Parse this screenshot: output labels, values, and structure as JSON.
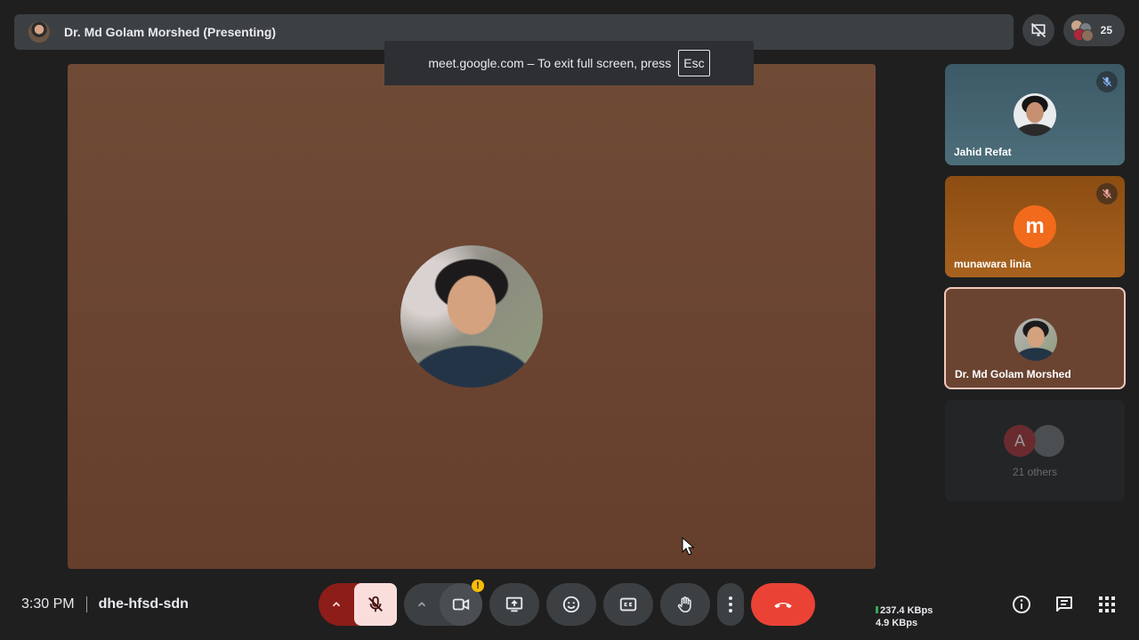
{
  "header": {
    "presenter_title": "Dr. Md Golam Morshed (Presenting)",
    "participant_count": "25"
  },
  "fullscreen_notice": {
    "text": "meet.google.com – To exit full screen, press",
    "key": "Esc"
  },
  "tiles": [
    {
      "name": "Jahid Refat",
      "muted": true,
      "avatar": "photo"
    },
    {
      "name": "munawara linia",
      "muted": true,
      "avatar_letter": "m",
      "avatar_color": "#f26a1b"
    },
    {
      "name": "Dr. Md Golam Morshed",
      "muted": false,
      "avatar": "photo",
      "active_speaker": true
    },
    {
      "others_label": "21 others",
      "avatar_letter": "A"
    }
  ],
  "bottom": {
    "time": "3:30 PM",
    "meeting_code": "dhe-hfsd-sdn",
    "bandwidth_up": "237.4 KBps",
    "bandwidth_down": "4.9 KBps"
  },
  "colors": {
    "end_call": "#ea4335",
    "mic_off_bg": "#f9dedc",
    "mic_group_bg": "#8c1d18",
    "warning": "#fbbc04"
  },
  "warning_badge": "!"
}
